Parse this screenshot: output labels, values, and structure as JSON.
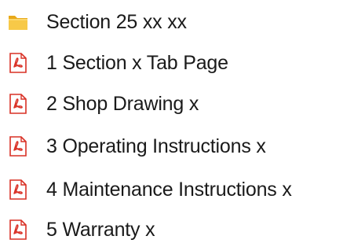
{
  "items": [
    {
      "label": "Section 25 xx xx",
      "icon": "folder-icon",
      "color": "#f5c542"
    },
    {
      "label": "1 Section x Tab Page",
      "icon": "pdf-icon",
      "color": "#d93025"
    },
    {
      "label": "2 Shop Drawing x",
      "icon": "pdf-icon",
      "color": "#d93025"
    },
    {
      "label": "3 Operating Instructions x",
      "icon": "pdf-icon",
      "color": "#d93025"
    },
    {
      "label": "4 Maintenance Instructions x",
      "icon": "pdf-icon",
      "color": "#d93025"
    },
    {
      "label": "5 Warranty x",
      "icon": "pdf-icon",
      "color": "#d93025"
    }
  ]
}
